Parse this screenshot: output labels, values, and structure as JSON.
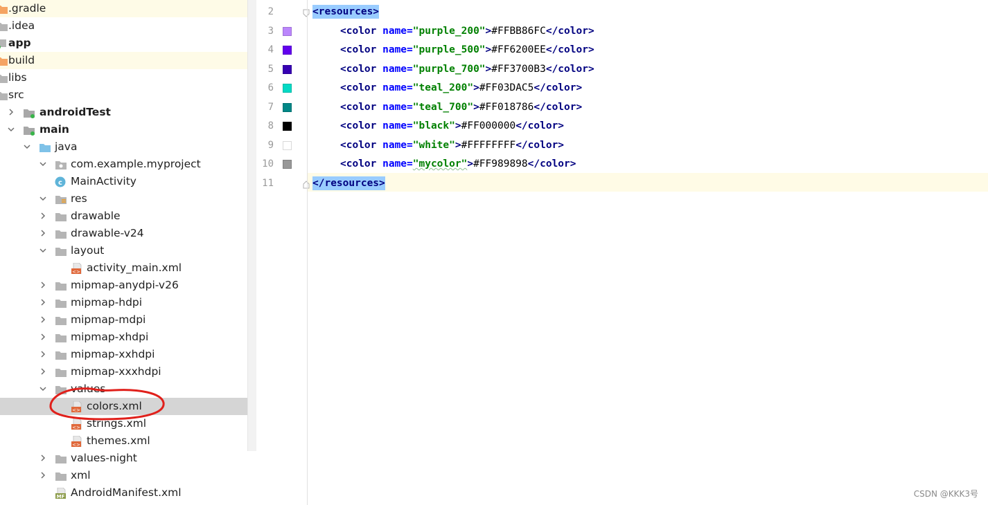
{
  "project_tree": {
    "items": [
      {
        "label": ".gradle",
        "icon": "folder-orange-icon",
        "bold": false
      },
      {
        "label": ".idea",
        "icon": "folder-icon",
        "bold": false
      },
      {
        "label": "app",
        "icon": "module-icon",
        "bold": true
      },
      {
        "label": "build",
        "icon": "folder-orange-icon",
        "bold": false
      },
      {
        "label": "libs",
        "icon": "folder-icon",
        "bold": false
      },
      {
        "label": "src",
        "icon": "folder-icon",
        "bold": false
      },
      {
        "label": "androidTest",
        "icon": "source-folder-icon",
        "bold": true
      },
      {
        "label": "main",
        "icon": "source-folder-icon",
        "bold": true
      },
      {
        "label": "java",
        "icon": "java-folder-icon",
        "bold": false
      },
      {
        "label": "com.example.myproject",
        "icon": "package-icon",
        "bold": false
      },
      {
        "label": "MainActivity",
        "icon": "class-icon",
        "bold": false
      },
      {
        "label": "res",
        "icon": "resources-folder-icon",
        "bold": false
      },
      {
        "label": "drawable",
        "icon": "folder-icon",
        "bold": false
      },
      {
        "label": "drawable-v24",
        "icon": "folder-icon",
        "bold": false
      },
      {
        "label": "layout",
        "icon": "folder-icon",
        "bold": false
      },
      {
        "label": "activity_main.xml",
        "icon": "xml-file-icon",
        "bold": false
      },
      {
        "label": "mipmap-anydpi-v26",
        "icon": "folder-icon",
        "bold": false
      },
      {
        "label": "mipmap-hdpi",
        "icon": "folder-icon",
        "bold": false
      },
      {
        "label": "mipmap-mdpi",
        "icon": "folder-icon",
        "bold": false
      },
      {
        "label": "mipmap-xhdpi",
        "icon": "folder-icon",
        "bold": false
      },
      {
        "label": "mipmap-xxhdpi",
        "icon": "folder-icon",
        "bold": false
      },
      {
        "label": "mipmap-xxxhdpi",
        "icon": "folder-icon",
        "bold": false
      },
      {
        "label": "values",
        "icon": "folder-icon",
        "bold": false
      },
      {
        "label": "colors.xml",
        "icon": "xml-file-icon",
        "bold": false,
        "selected": true
      },
      {
        "label": "strings.xml",
        "icon": "xml-file-icon",
        "bold": false
      },
      {
        "label": "themes.xml",
        "icon": "xml-file-icon",
        "bold": false
      },
      {
        "label": "values-night",
        "icon": "folder-icon",
        "bold": false
      },
      {
        "label": "xml",
        "icon": "folder-icon",
        "bold": false
      },
      {
        "label": "AndroidManifest.xml",
        "icon": "manifest-file-icon",
        "bold": false
      }
    ]
  },
  "editor": {
    "lines": [
      {
        "num": "2",
        "kind": "open",
        "tag": "resources"
      },
      {
        "num": "3",
        "kind": "color",
        "name": "purple_200",
        "value": "#FFBB86FC",
        "swatch": "#BB86FC"
      },
      {
        "num": "4",
        "kind": "color",
        "name": "purple_500",
        "value": "#FF6200EE",
        "swatch": "#6200EE"
      },
      {
        "num": "5",
        "kind": "color",
        "name": "purple_700",
        "value": "#FF3700B3",
        "swatch": "#3700B3"
      },
      {
        "num": "6",
        "kind": "color",
        "name": "teal_200",
        "value": "#FF03DAC5",
        "swatch": "#03DAC5"
      },
      {
        "num": "7",
        "kind": "color",
        "name": "teal_700",
        "value": "#FF018786",
        "swatch": "#018786"
      },
      {
        "num": "8",
        "kind": "color",
        "name": "black",
        "value": "#FF000000",
        "swatch": "#000000"
      },
      {
        "num": "9",
        "kind": "color",
        "name": "white",
        "value": "#FFFFFFFF",
        "swatch": "#FFFFFF"
      },
      {
        "num": "10",
        "kind": "color",
        "name": "mycolor",
        "value": "#FF989898",
        "swatch": "#989898"
      },
      {
        "num": "11",
        "kind": "close",
        "tag": "resources"
      }
    ],
    "attr_name": "name",
    "element": "color"
  },
  "watermark": "CSDN @KKK3号",
  "colors": {
    "selection_bg": "#99ccff",
    "annotation": "#e0201b"
  }
}
